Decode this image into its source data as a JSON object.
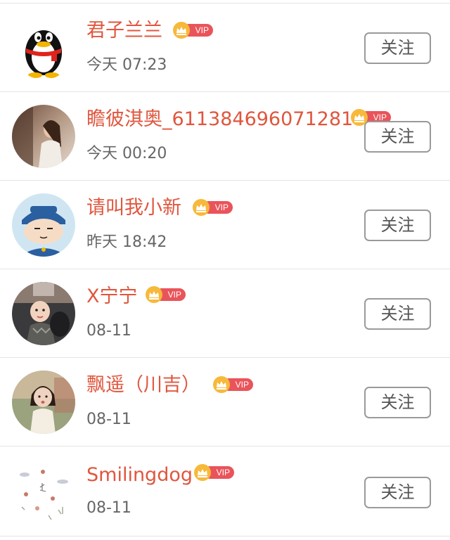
{
  "follow_list": {
    "items": [
      {
        "name": "君子兰兰",
        "time": "今天 07:23",
        "vip_label": "VIP",
        "button_label": "关注",
        "avatar_icon": "qq-penguin-avatar"
      },
      {
        "name": "瞻彼淇奥_611384696071281",
        "time": "今天 00:20",
        "vip_label": "VIP",
        "button_label": "关注",
        "avatar_icon": "woman-photo-avatar"
      },
      {
        "name": "请叫我小新",
        "time": "昨天 18:42",
        "vip_label": "VIP",
        "button_label": "关注",
        "avatar_icon": "cartoon-boy-avatar"
      },
      {
        "name": "X宁宁",
        "time": "08-11",
        "vip_label": "VIP",
        "button_label": "关注",
        "avatar_icon": "baby-photo-avatar"
      },
      {
        "name": "飘遥（川吉）",
        "time": "08-11",
        "vip_label": "VIP",
        "button_label": "关注",
        "avatar_icon": "little-girl-photo-avatar"
      },
      {
        "name": "Smilingdog",
        "time": "08-11",
        "vip_label": "VIP",
        "button_label": "关注",
        "avatar_icon": "flower-sketch-avatar"
      }
    ]
  },
  "colors": {
    "name_text": "#e0563e",
    "time_text": "#666666",
    "vip_badge": "#e9545a",
    "vip_crown": "#f7b93a",
    "button_border": "#9a9a9a",
    "divider": "#e4e4e4"
  }
}
